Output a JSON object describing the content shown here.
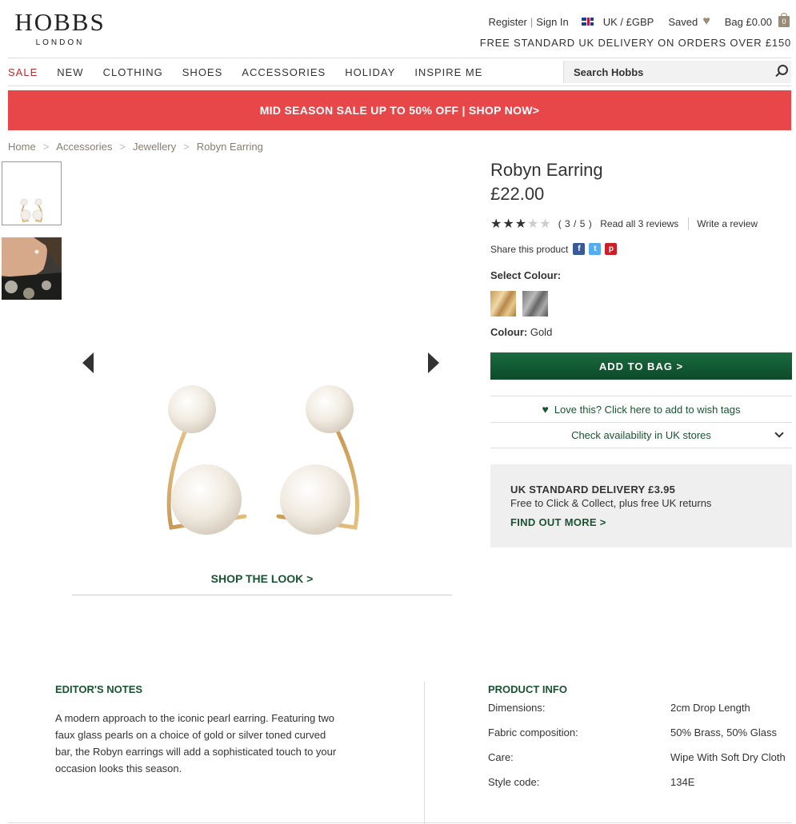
{
  "brand": {
    "name": "HOBBS",
    "sub": "LONDON"
  },
  "topbar": {
    "register": "Register",
    "sign_in": "Sign In",
    "locale": "UK / £GBP",
    "saved": "Saved",
    "bag": "Bag £0.00",
    "bag_count": "0"
  },
  "delivery_strip": "FREE STANDARD UK DELIVERY ON ORDERS OVER £150",
  "nav": {
    "items": [
      "SALE",
      "NEW",
      "CLOTHING",
      "SHOES",
      "ACCESSORIES",
      "HOLIDAY",
      "INSPIRE ME"
    ],
    "search_placeholder": "Search Hobbs"
  },
  "banner": "MID SEASON SALE UP TO 50% OFF | SHOP NOW>",
  "breadcrumb": [
    "Home",
    "Accessories",
    "Jewellery",
    "Robyn Earring"
  ],
  "product": {
    "title": "Robyn Earring",
    "price": "£22.00",
    "rating_value": 3,
    "rating_max": 5,
    "rating_text": "( 3 / 5 )",
    "read_reviews": "Read all 3 reviews",
    "write_review": "Write a review",
    "share_label": "Share this product",
    "select_colour": "Select Colour:",
    "colour_label": "Colour:",
    "colour_value": "Gold",
    "add_to_bag": "ADD TO BAG >",
    "wishlist": "Love this? Click here to add to wish tags",
    "availability": "Check availability in UK stores",
    "shop_the_look": "SHOP THE LOOK >"
  },
  "delivery_box": {
    "title": "UK STANDARD DELIVERY £3.95",
    "subtitle": "Free to Click & Collect, plus free UK returns",
    "link": "FIND OUT MORE >"
  },
  "editors_notes": {
    "title": "EDITOR'S NOTES",
    "text": "A modern approach to the iconic pearl earring. Featuring two faux glass pearls on a choice of gold or silver toned curved bar, the Robyn earrings will add a sophisticated touch to your occasion looks this season."
  },
  "product_info": {
    "title": "PRODUCT INFO",
    "rows": [
      {
        "label": "Dimensions:",
        "value": "2cm Drop Length"
      },
      {
        "label": "Fabric composition:",
        "value": "50% Brass, 50% Glass"
      },
      {
        "label": "Care:",
        "value": "Wipe With Soft Dry Cloth"
      },
      {
        "label": "Style code:",
        "value": "134E"
      }
    ]
  },
  "colors": {
    "accent_green": "#1a5332",
    "sale_red": "#e8474a",
    "brand_taupe": "#9a8c77"
  }
}
